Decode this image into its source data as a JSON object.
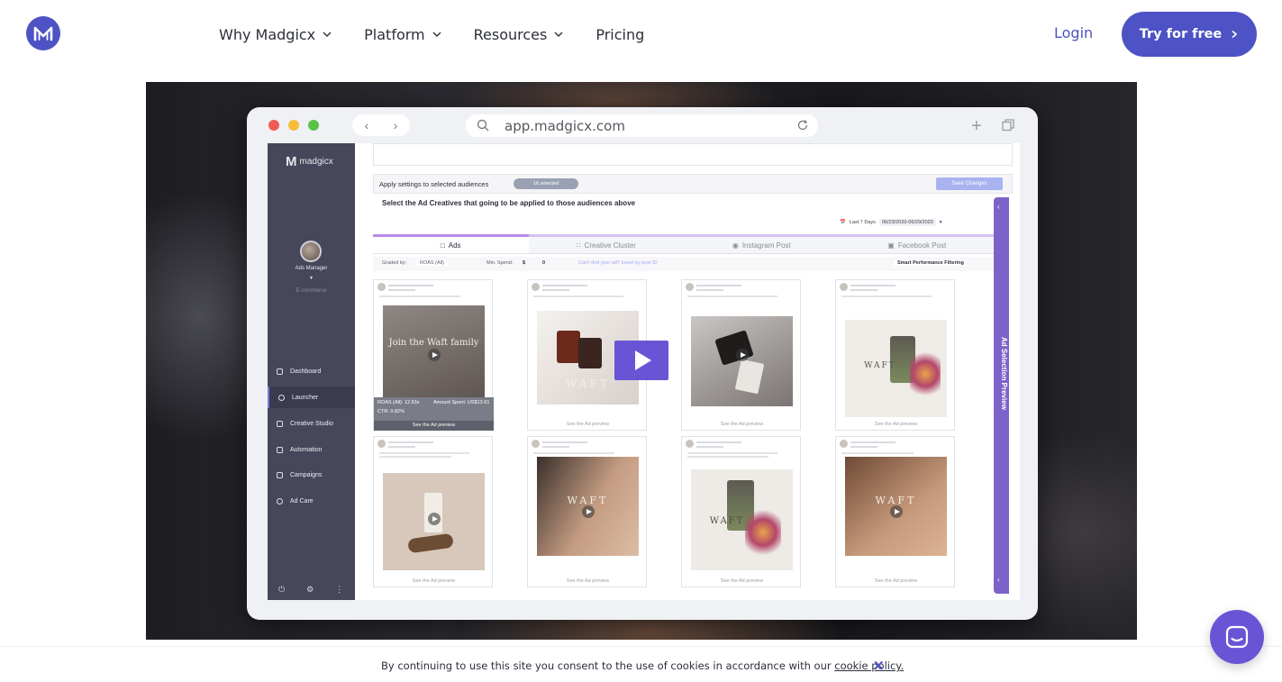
{
  "nav": {
    "items": [
      {
        "label": "Why Madgicx",
        "has_dropdown": true
      },
      {
        "label": "Platform",
        "has_dropdown": true
      },
      {
        "label": "Resources",
        "has_dropdown": true
      },
      {
        "label": "Pricing",
        "has_dropdown": false
      }
    ],
    "login": "Login",
    "cta": "Try for free"
  },
  "colors": {
    "brand": "#4d53c4",
    "accent_purple": "#6a54d6"
  },
  "video": {
    "browser": {
      "url": "app.madgicx.com"
    },
    "app": {
      "brand": "madgicx",
      "account_name": "Ads Manager",
      "account_type": "E-commerce",
      "sidebar": [
        {
          "label": "Dashboard",
          "icon": "bar-chart-icon",
          "active": false
        },
        {
          "label": "Launcher",
          "icon": "target-icon",
          "active": true
        },
        {
          "label": "Creative Studio",
          "icon": "image-icon",
          "active": false
        },
        {
          "label": "Automation",
          "icon": "sliders-icon",
          "active": false
        },
        {
          "label": "Campaigns",
          "icon": "megaphone-icon",
          "active": false
        },
        {
          "label": "Ad Care",
          "icon": "heart-icon",
          "active": false
        }
      ],
      "apply_label": "Apply settings to selected audiences",
      "selected_pill": "16 selected",
      "save_changes": "Save Changes",
      "select_label": "Select the Ad Creatives that going to be applied to those audiences above",
      "date_range_label": "Last 7 Days",
      "date_range": "06/23/2020-06/29/2020",
      "tabs": [
        "Ads",
        "Creative Cluster",
        "Instagram Post",
        "Facebook Post"
      ],
      "filters": {
        "graded_by_label": "Graded by:",
        "graded_by_value": "ROAS (All)",
        "min_spend_label": "Min. Spend:",
        "min_spend_currency": "$",
        "min_spend_value": "0",
        "cant_find": "Can't find your ad? Insert by post ID",
        "smart": "Smart Performance Filtering"
      },
      "hover_stats": {
        "roas": "ROAS (All): 12.63x",
        "amount": "Amount Spent: US$13.61",
        "ctr": "CTR: 0.82%"
      },
      "card_footer": "See the Ad preview",
      "card_image_texts": [
        "Join the Waft family",
        "WAFT",
        "WAFT",
        "WAFT",
        "WAFT",
        "WAFT"
      ],
      "side_preview": "Ad Selection Preview"
    }
  },
  "cookie": {
    "message": "By continuing to use this site you consent to the use of cookies in accordance with our",
    "link": "cookie policy."
  }
}
